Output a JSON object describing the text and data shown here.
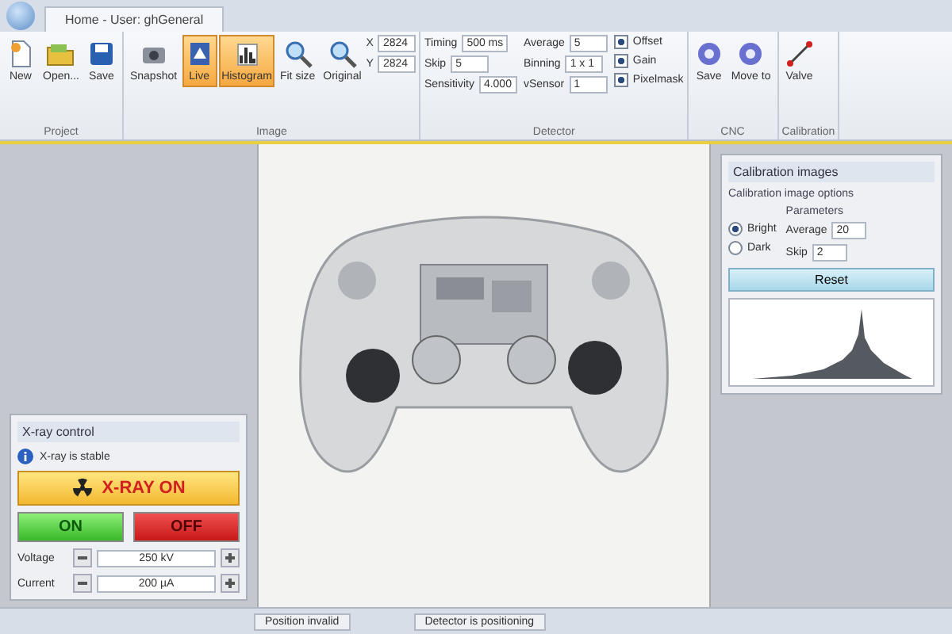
{
  "tab": {
    "label": "Home - User: ghGeneral",
    "selected": true
  },
  "ribbon": [
    {
      "label": "Project",
      "buttons": [
        {
          "label": "New",
          "selected": false
        },
        {
          "label": "Open...",
          "selected": false
        },
        {
          "label": "Save",
          "selected": false
        }
      ]
    },
    {
      "label": "Image",
      "buttons": [
        {
          "label": "Snapshot",
          "selected": false
        },
        {
          "label": "Live",
          "selected": true
        },
        {
          "label": "Histogram",
          "selected": true
        },
        {
          "label": "Fit size",
          "selected": false
        },
        {
          "label": "Original",
          "selected": false
        }
      ],
      "fields": [
        {
          "label": "X",
          "value": "2824"
        },
        {
          "label": "Y",
          "value": "2824"
        }
      ]
    },
    {
      "label": "Detector",
      "fields": [
        {
          "label": "Timing",
          "value": "500 ms"
        },
        {
          "label": "Average",
          "value": "5"
        },
        {
          "label": "Skip",
          "value": "5"
        },
        {
          "label": "Binning",
          "value": "1 x 1"
        },
        {
          "label": "Sensitivity",
          "value": "4.000"
        },
        {
          "label": "vSensor",
          "value": "1"
        }
      ],
      "checks": [
        {
          "label": "Offset",
          "checked": true
        },
        {
          "label": "Gain",
          "checked": true
        },
        {
          "label": "Pixelmask",
          "checked": true
        }
      ]
    },
    {
      "label": "CNC",
      "buttons": [
        {
          "label": "Save",
          "selected": false
        },
        {
          "label": "Move to",
          "selected": false
        }
      ]
    },
    {
      "label": "Calibration",
      "buttons": [
        {
          "label": "Valve",
          "selected": false
        }
      ]
    }
  ],
  "xray": {
    "title": "X-ray control",
    "message": "X-ray is stable",
    "status": "X-RAY ON",
    "on": "ON",
    "off": "OFF",
    "settings": [
      {
        "label": "Voltage",
        "value": "250 kV"
      },
      {
        "label": "Current",
        "value": "200 µA"
      }
    ]
  },
  "calibration": {
    "title": "Calibration images",
    "options_title": "Calibration image options",
    "modes": [
      {
        "label": "Bright",
        "selected": true
      },
      {
        "label": "Dark",
        "selected": false
      }
    ],
    "params_title": "Parameters",
    "params": [
      {
        "label": "Average",
        "value": "20"
      },
      {
        "label": "Skip",
        "value": "2"
      }
    ],
    "reset": "Reset"
  },
  "status_bar": [
    "Position invalid",
    "Detector is positioning"
  ]
}
